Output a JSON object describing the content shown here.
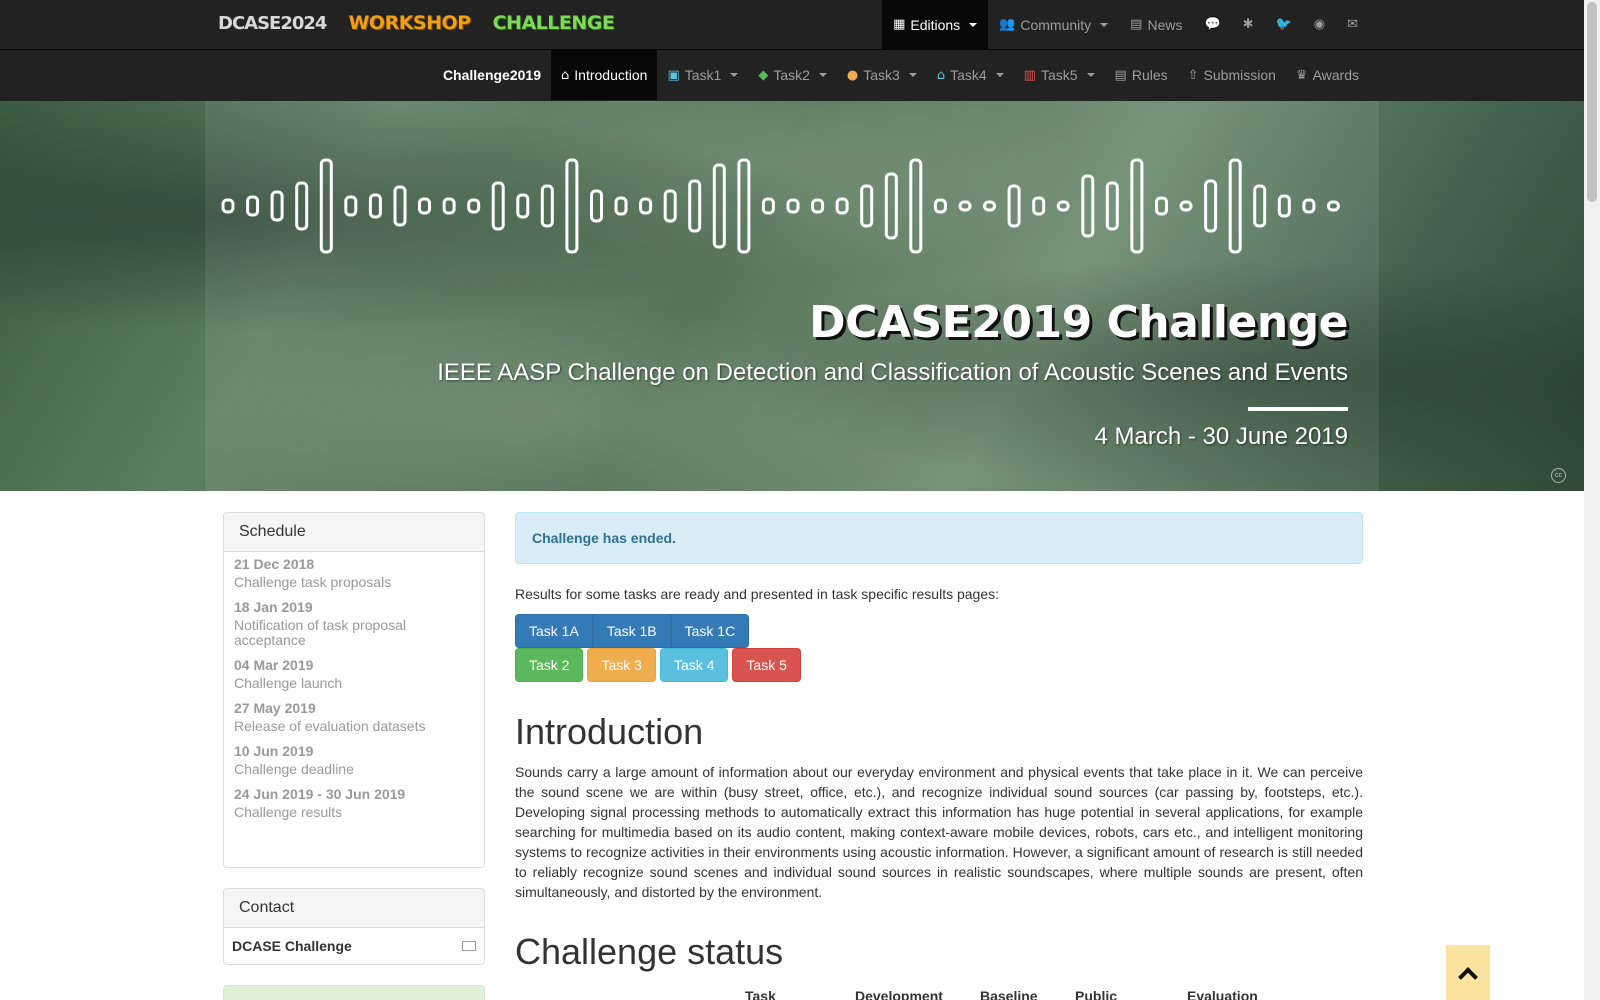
{
  "brand": {
    "part1": "DCASE2024",
    "part2": "WORKSHOP",
    "part3": "CHALLENGE"
  },
  "topnav": [
    {
      "icon": "calendar-icon",
      "glyph": "▦",
      "label": "Editions",
      "dropdown": true,
      "active": true
    },
    {
      "icon": "users-icon",
      "glyph": "👥",
      "label": "Community",
      "dropdown": true,
      "active": false
    },
    {
      "icon": "newspaper-icon",
      "glyph": "▤",
      "label": "News",
      "dropdown": false,
      "active": false
    },
    {
      "icon": "chat-icon",
      "glyph": "💬",
      "label": "",
      "dropdown": false,
      "active": false
    },
    {
      "icon": "slack-icon",
      "glyph": "✱",
      "label": "",
      "dropdown": false,
      "active": false
    },
    {
      "icon": "twitter-icon",
      "glyph": "🐦",
      "label": "",
      "dropdown": false,
      "active": false
    },
    {
      "icon": "github-icon",
      "glyph": "◉",
      "label": "",
      "dropdown": false,
      "active": false
    },
    {
      "icon": "envelope-icon",
      "glyph": "✉",
      "label": "",
      "dropdown": false,
      "active": false
    }
  ],
  "subnav": {
    "brand": "Challenge2019",
    "items": [
      {
        "icon": "home-icon",
        "glyph": "⌂",
        "label": "Introduction",
        "dropdown": false,
        "active": true,
        "color": "#ffffff"
      },
      {
        "icon": "image-icon",
        "glyph": "▣",
        "label": "Task1",
        "dropdown": true,
        "active": false,
        "color": "#5bc0de"
      },
      {
        "icon": "tags-icon",
        "glyph": "◆",
        "label": "Task2",
        "dropdown": true,
        "active": false,
        "color": "#5cb85c"
      },
      {
        "icon": "map-marker-icon",
        "glyph": "●",
        "label": "Task3",
        "dropdown": true,
        "active": false,
        "color": "#f0ad4e"
      },
      {
        "icon": "home-icon",
        "glyph": "⌂",
        "label": "Task4",
        "dropdown": true,
        "active": false,
        "color": "#5bc0de"
      },
      {
        "icon": "industry-icon",
        "glyph": "▥",
        "label": "Task5",
        "dropdown": true,
        "active": false,
        "color": "#d9534f"
      },
      {
        "icon": "list-icon",
        "glyph": "▤",
        "label": "Rules",
        "dropdown": false,
        "active": false,
        "color": "#9d9d9d"
      },
      {
        "icon": "upload-icon",
        "glyph": "⇧",
        "label": "Submission",
        "dropdown": false,
        "active": false,
        "color": "#9d9d9d"
      },
      {
        "icon": "trophy-icon",
        "glyph": "♛",
        "label": "Awards",
        "dropdown": false,
        "active": false,
        "color": "#9d9d9d"
      }
    ]
  },
  "hero": {
    "title": "DCASE2019 Challenge",
    "subtitle": "IEEE AASP Challenge on Detection and Classification of Acoustic Scenes and Events",
    "date": "4 March - 30 June 2019"
  },
  "schedule": {
    "title": "Schedule",
    "items": [
      {
        "date": "21 Dec 2018",
        "text": "Challenge task proposals"
      },
      {
        "date": "18 Jan 2019",
        "text": "Notification of task proposal acceptance"
      },
      {
        "date": "04 Mar 2019",
        "text": "Challenge launch"
      },
      {
        "date": "27 May 2019",
        "text": "Release of evaluation datasets"
      },
      {
        "date": "10 Jun 2019",
        "text": "Challenge deadline"
      },
      {
        "date": "24 Jun 2019 - 30 Jun 2019",
        "text": "Challenge results"
      }
    ]
  },
  "contact": {
    "title": "Contact",
    "name": "DCASE Challenge"
  },
  "alert": "Challenge has ended.",
  "results_line": "Results for some tasks are ready and presented in task specific results pages:",
  "task_buttons_row1": [
    "Task 1A",
    "Task 1B",
    "Task 1C"
  ],
  "task_buttons_row2": [
    "Task 2",
    "Task 3",
    "Task 4",
    "Task 5"
  ],
  "intro": {
    "heading": "Introduction",
    "paragraph": "Sounds carry a large amount of information about our everyday environment and physical events that take place in it. We can perceive the sound scene we are within (busy street, office, etc.), and recognize individual sound sources (car passing by, footsteps, etc.). Developing signal processing methods to automatically extract this information has huge potential in several applications, for example searching for multimedia based on its audio content, making context-aware mobile devices, robots, cars etc., and intelligent monitoring systems to recognize activities in their environments using acoustic information. However, a significant amount of research is still needed to reliably recognize sound scenes and individual sound sources in realistic soundscapes, where multiple sounds are present, often simultaneously, and distorted by the environment."
  },
  "status": {
    "heading": "Challenge status",
    "columns": [
      "Task",
      "Development",
      "Baseline",
      "Public",
      "Evaluation"
    ]
  },
  "colors": {
    "navbar": "#222222",
    "alert_bg": "#d9edf7",
    "alert_text": "#31708f",
    "back_to_top": "#fbe29e"
  }
}
